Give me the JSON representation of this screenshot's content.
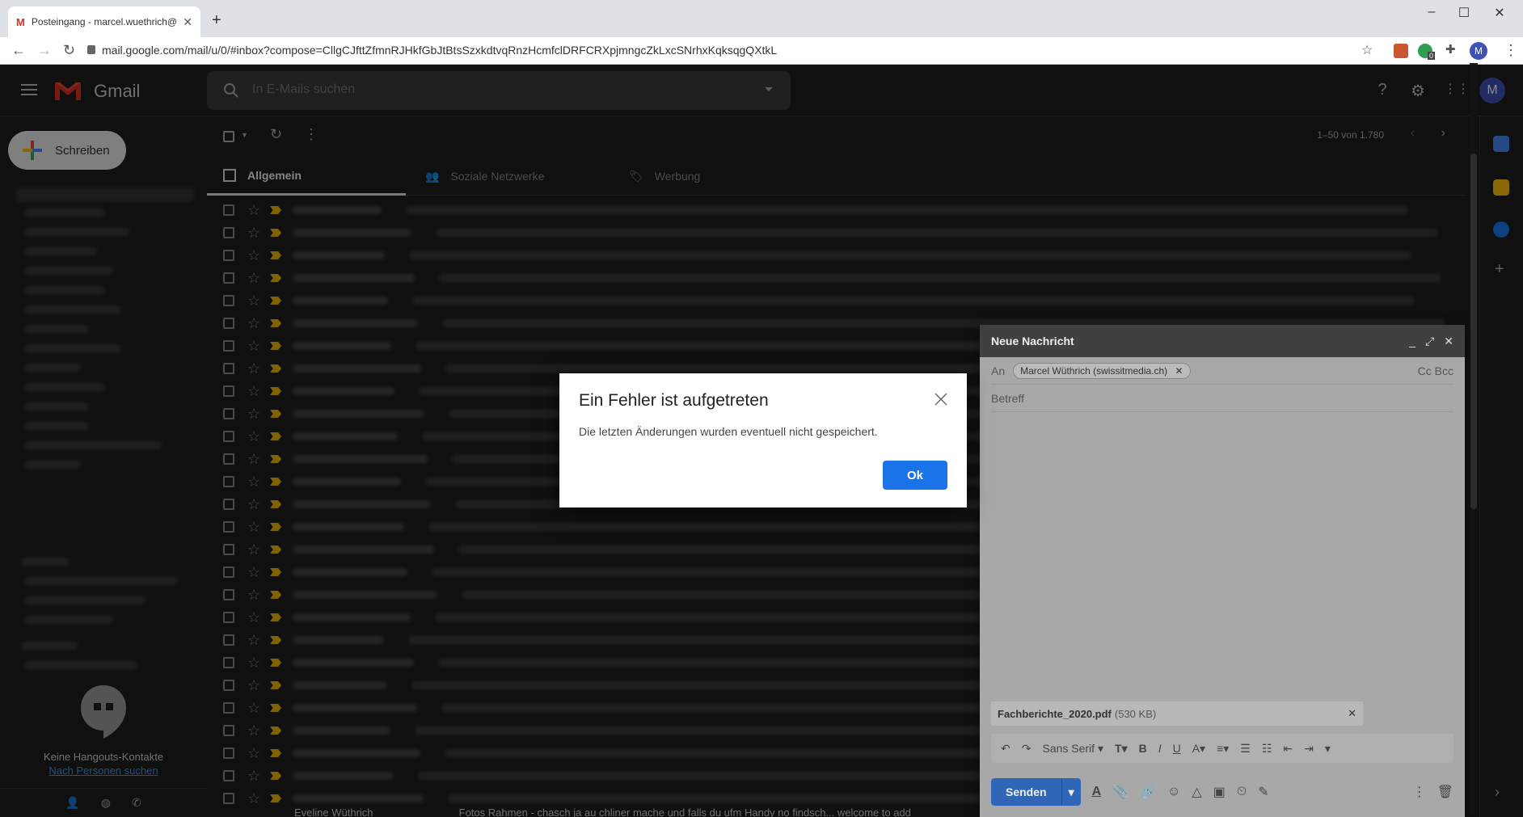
{
  "browser": {
    "tab_title": "Posteingang - marcel.wuethrich@",
    "url": "mail.google.com/mail/u/0/#inbox?compose=CllgCJfttZfmnRJHkfGbJtBtsSzxkdtvqRnzHcmfclDRFCRXpjmngcZkLxcSNrhxKqksqgQXtkL",
    "new_tab": "+",
    "profile_initial": "M",
    "ext_badge": "0"
  },
  "gmail": {
    "logo_text": "Gmail",
    "search_placeholder": "In E-Mails suchen",
    "avatar_initial": "M"
  },
  "sidebar": {
    "compose_label": "Schreiben",
    "hangouts_empty": "Keine Hangouts-Kontakte",
    "hangouts_link": "Nach Personen suchen"
  },
  "toolbar": {
    "pager": "1–50 von 1.780"
  },
  "category_tabs": [
    {
      "label": "Allgemein",
      "active": true
    },
    {
      "label": "Soziale Netzwerke",
      "active": false
    },
    {
      "label": "Werbung",
      "active": false
    }
  ],
  "email_list": {
    "visible_row_count": 27,
    "last_row": {
      "sender": "Eveline Wüthrich",
      "preview": "Fotos Rahmen - chasch ja au chliner mache und falls du ufm Handy no findsch... welcome to add"
    }
  },
  "compose": {
    "title": "Neue Nachricht",
    "to_label": "An",
    "recipient": "Marcel Wüthrich (swissitmedia.ch)",
    "cc_bcc": "Cc Bcc",
    "subject_placeholder": "Betreff",
    "attachment_name": "Fachberichte_2020.pdf",
    "attachment_size": "(530 KB)",
    "font_select": "Sans Serif",
    "send_label": "Senden"
  },
  "dialog": {
    "title": "Ein Fehler ist aufgetreten",
    "message": "Die letzten Änderungen wurden eventuell nicht gespeichert.",
    "ok_label": "Ok"
  },
  "colors": {
    "primary_button": "#1a73e8",
    "send_button": "#3066b8",
    "important_marker": "#e8b400",
    "app_background": "#1e1e1e"
  }
}
